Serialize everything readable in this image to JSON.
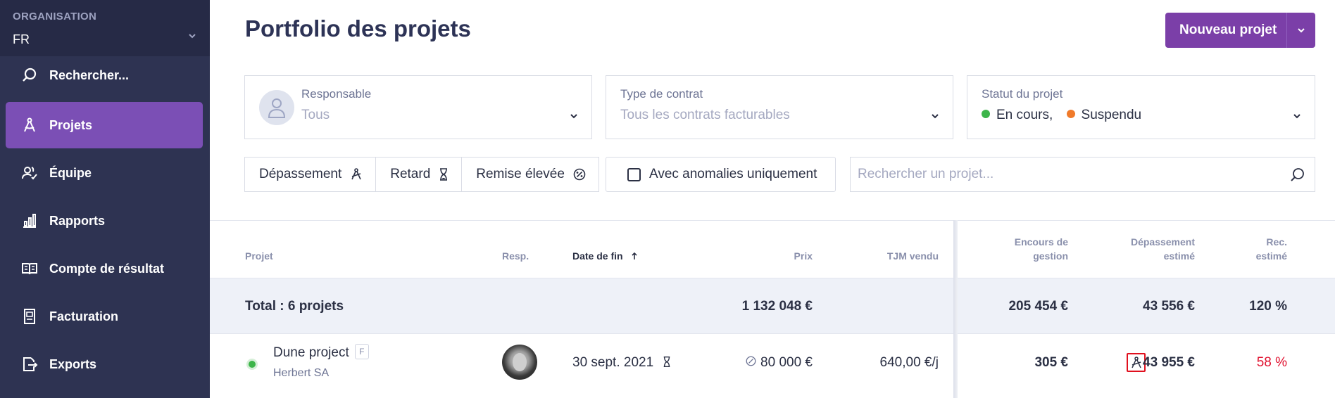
{
  "sidebar": {
    "org_label": "ORGANISATION",
    "org_value": "FR",
    "items": [
      {
        "label": "Rechercher...",
        "icon": "search-icon"
      },
      {
        "label": "Projets",
        "icon": "compass-icon",
        "active": true
      },
      {
        "label": "Équipe",
        "icon": "team-icon"
      },
      {
        "label": "Rapports",
        "icon": "bar-chart-icon"
      },
      {
        "label": "Compte de résultat",
        "icon": "book-icon"
      },
      {
        "label": "Facturation",
        "icon": "invoice-icon"
      },
      {
        "label": "Exports",
        "icon": "export-icon"
      }
    ]
  },
  "header": {
    "title": "Portfolio des projets",
    "new_button": "Nouveau projet"
  },
  "filters": {
    "responsable": {
      "label": "Responsable",
      "value": "Tous"
    },
    "contrat": {
      "label": "Type de contrat",
      "value": "Tous les contrats facturables"
    },
    "statut": {
      "label": "Statut du projet",
      "values": [
        "En cours,",
        "Suspendu"
      ]
    },
    "chips": [
      "Dépassement",
      "Retard",
      "Remise élevée"
    ],
    "anomalies": "Avec anomalies uniquement",
    "search_placeholder": "Rechercher un projet..."
  },
  "table": {
    "headers": {
      "projet": "Projet",
      "resp": "Resp.",
      "date_fin": "Date de fin",
      "prix": "Prix",
      "tjm": "TJM vendu",
      "encours_1": "Encours de",
      "encours_2": "gestion",
      "depassement_1": "Dépassement",
      "depassement_2": "estimé",
      "rec_1": "Rec.",
      "rec_2": "estimé"
    },
    "total": {
      "label": "Total : 6 projets",
      "prix": "1 132 048 €",
      "encours": "205 454 €",
      "depassement": "43 556 €",
      "rec": "120 %"
    },
    "rows": [
      {
        "name": "Dune project",
        "badge": "F",
        "client": "Herbert SA",
        "date_fin": "30 sept. 2021",
        "prix": "80 000 €",
        "tjm": "640,00 €/j",
        "encours": "305 €",
        "depassement": "43 955 €",
        "rec": "58 %"
      }
    ]
  },
  "colors": {
    "sidebar_bg": "#2e3352",
    "accent": "#7b4fb5",
    "status_green": "#3db54a",
    "status_orange": "#f07a2a",
    "negative_red": "#e0102e"
  }
}
